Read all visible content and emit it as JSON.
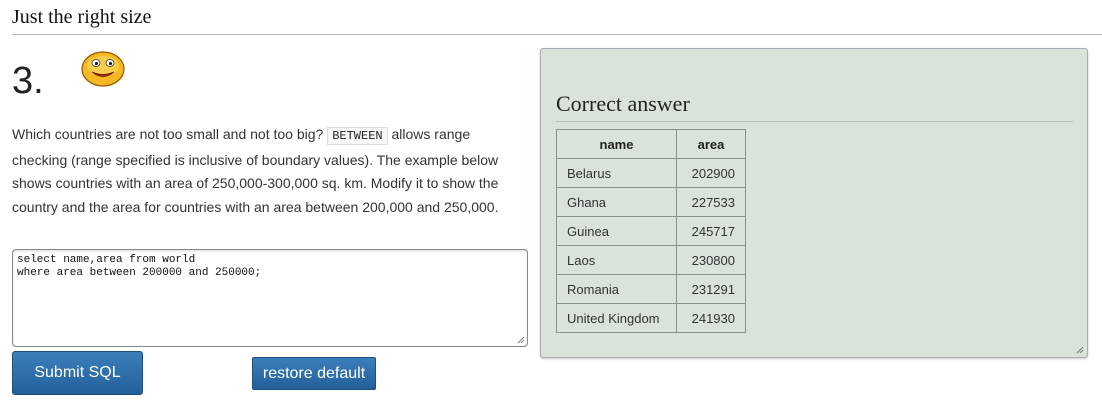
{
  "page": {
    "section_title": "Just the right size"
  },
  "question": {
    "number": "3.",
    "text_before": "Which countries are not too small and not too big? ",
    "code_keyword": "BETWEEN",
    "text_after": " allows range checking (range specified is inclusive of boundary values). The example below shows countries with an area of 250,000-300,000 sq. km. Modify it to show the country and the area for countries with an area between 200,000 and 250,000."
  },
  "editor": {
    "sql": "select name,area from world\nwhere area between 200000 and 250000;"
  },
  "buttons": {
    "submit": "Submit SQL",
    "restore": "restore default"
  },
  "answer": {
    "title": "Correct answer",
    "columns": [
      "name",
      "area"
    ],
    "rows": [
      [
        "Belarus",
        "202900"
      ],
      [
        "Ghana",
        "227533"
      ],
      [
        "Guinea",
        "245717"
      ],
      [
        "Laos",
        "230800"
      ],
      [
        "Romania",
        "231291"
      ],
      [
        "United Kingdom",
        "241930"
      ]
    ]
  },
  "icons": {
    "smiley": "smiley-face-icon",
    "resize": "resize-grip-icon"
  },
  "colors": {
    "button": "#2a6aa0",
    "answer_panel": "#d9e3d9"
  }
}
